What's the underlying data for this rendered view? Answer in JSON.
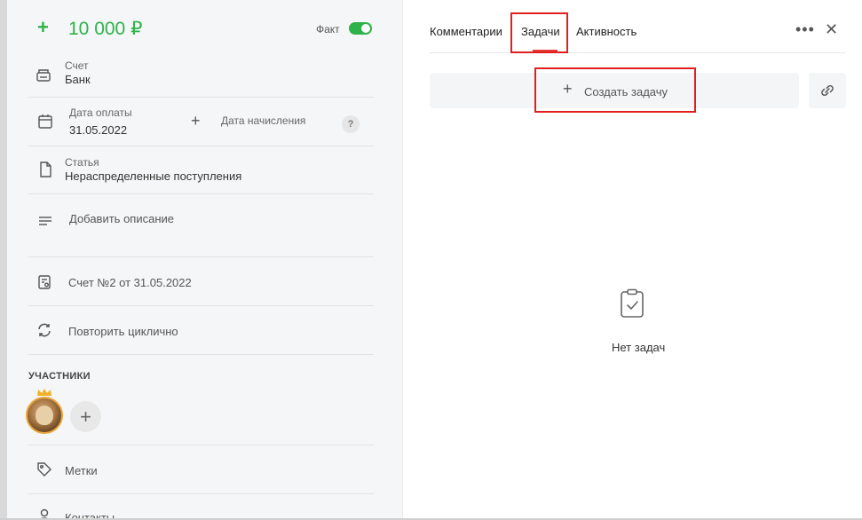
{
  "header": {
    "plus": "+",
    "amount": "10 000 ₽",
    "fact_label": "Факт",
    "fact_toggle_on": true,
    "accent_color": "#2db34a"
  },
  "fields": {
    "account": {
      "label": "Счет",
      "value": "Банк",
      "icon": "card-reader-icon"
    },
    "payment_date": {
      "label": "Дата оплаты",
      "value": "31.05.2022",
      "icon": "calendar-icon"
    },
    "accrual_date": {
      "plus": "+",
      "label": "Дата начисления",
      "help": "?"
    },
    "article": {
      "label": "Статья",
      "value": "Нераспределенные поступления",
      "icon": "document-icon"
    },
    "description": {
      "placeholder": "Добавить описание",
      "icon": "text-lines-icon"
    },
    "invoice": {
      "value": "Счет №2 от 31.05.2022",
      "icon": "invoice-icon"
    },
    "repeat": {
      "value": "Повторить циклично",
      "icon": "repeat-icon"
    },
    "tags": {
      "value": "Метки",
      "icon": "tag-icon"
    },
    "contacts": {
      "value": "Контакты",
      "icon": "person-icon"
    }
  },
  "participants": {
    "title": "УЧАСТНИКИ",
    "add": "+"
  },
  "tabs": [
    {
      "label": "Комментарии",
      "active": false
    },
    {
      "label": "Задачи",
      "active": true
    },
    {
      "label": "Активность",
      "active": false
    }
  ],
  "toolbar": {
    "more": "•••",
    "close": "✕"
  },
  "tasks": {
    "create_plus": "+",
    "create_label": "Создать задачу",
    "empty_text": "Нет задач"
  },
  "colors": {
    "highlight": "#e02020",
    "active_tab_underline": "#e53935"
  }
}
